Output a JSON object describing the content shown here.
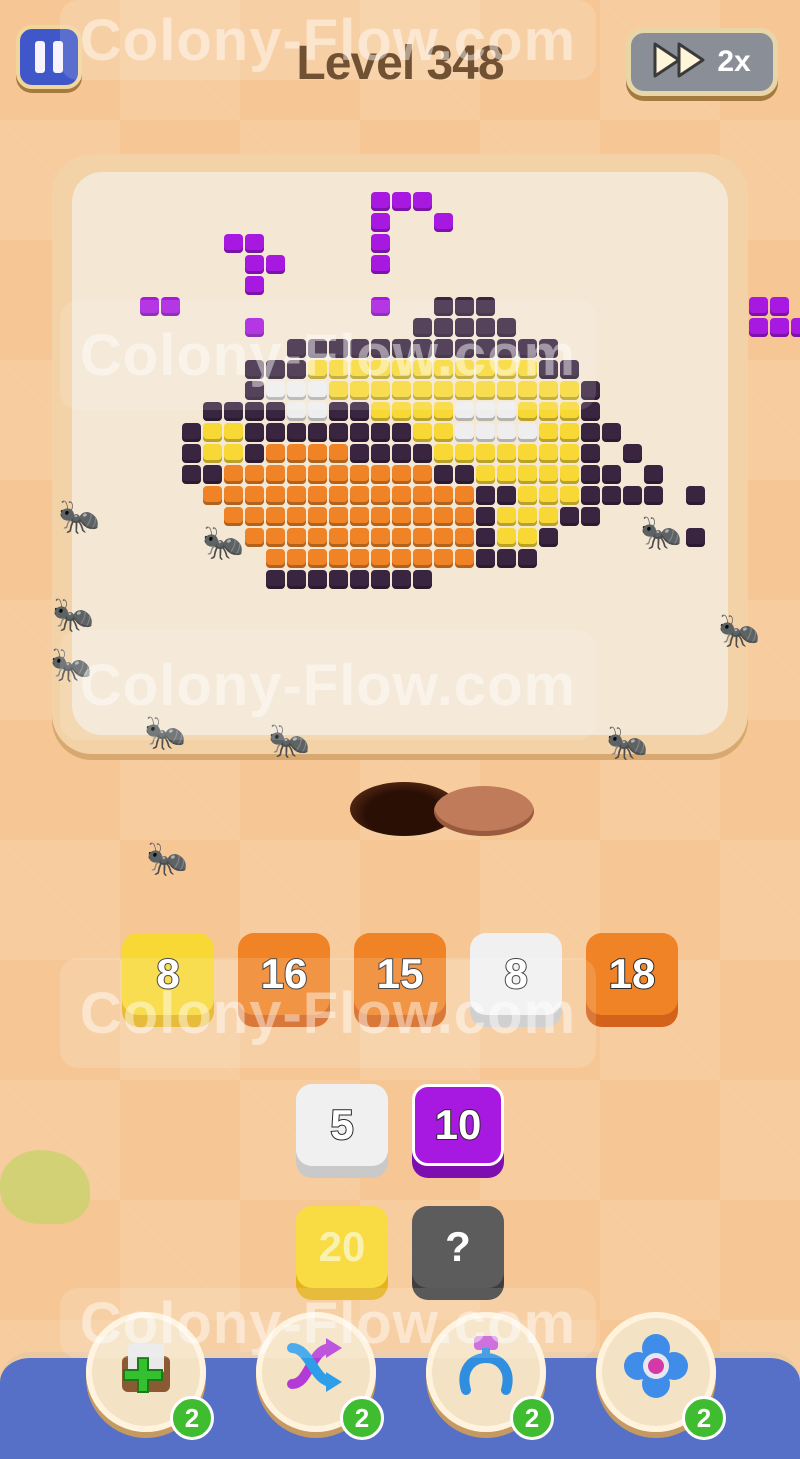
{
  "header": {
    "level_title": "Level 348",
    "speed_label": "2x",
    "pause_icon": "pause-icon",
    "fast_forward_icon": "fast-forward-icon"
  },
  "watermark": "Colony-Flow.com",
  "colors": {
    "purple": "#a718e0",
    "dark": "#3a2540",
    "yellow": "#f7d834",
    "white": "#eeeeee",
    "orange": "#ef8326",
    "background": "#f6c795",
    "board": "#f4e7d3"
  },
  "queue_tiles": [
    {
      "value": "8",
      "color": "yellow"
    },
    {
      "value": "16",
      "color": "orange"
    },
    {
      "value": "15",
      "color": "orange"
    },
    {
      "value": "8",
      "color": "white"
    },
    {
      "value": "18",
      "color": "orange"
    }
  ],
  "stack_tiles": [
    {
      "value": "5",
      "color": "white"
    },
    {
      "value": "10",
      "color": "purple"
    },
    {
      "value": "20",
      "color": "yellow-dim"
    },
    {
      "value": "?",
      "color": "mystery"
    }
  ],
  "boosters": [
    {
      "icon": "add-box-icon",
      "count": "2"
    },
    {
      "icon": "shuffle-arrows-icon",
      "count": "2"
    },
    {
      "icon": "magnet-claw-icon",
      "count": "2"
    },
    {
      "icon": "flower-button-icon",
      "count": "2"
    }
  ]
}
